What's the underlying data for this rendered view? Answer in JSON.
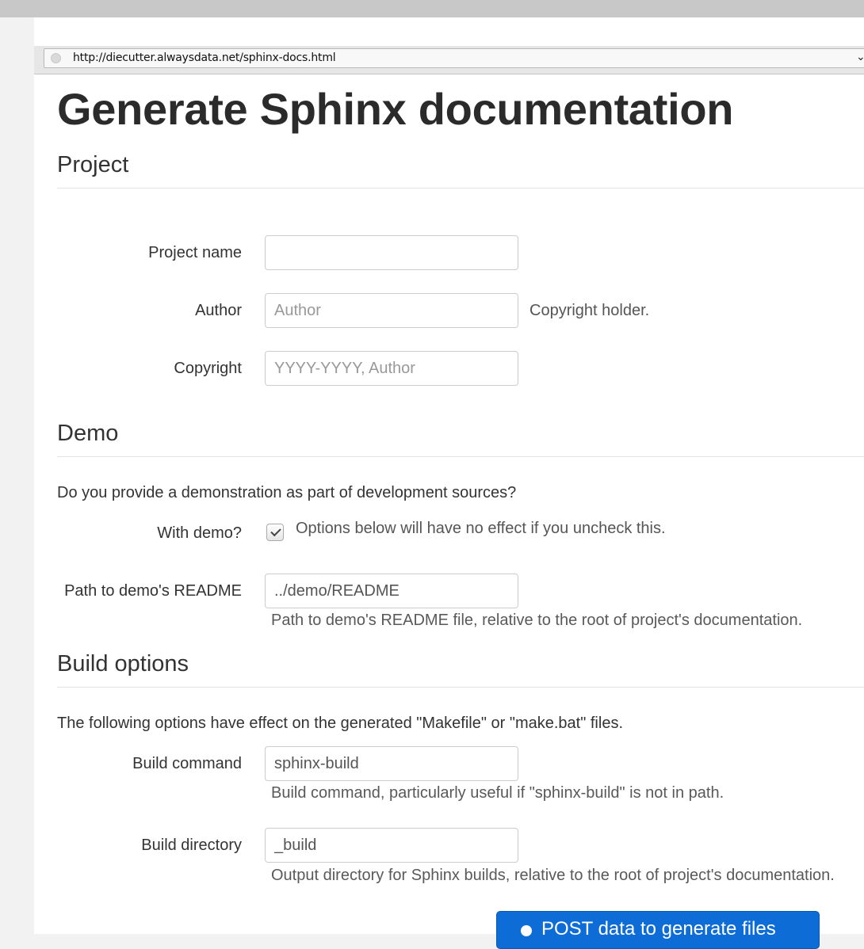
{
  "browser": {
    "url": "http://diecutter.alwaysdata.net/sphinx-docs.html"
  },
  "page": {
    "title": "Generate Sphinx documentation",
    "project": {
      "legend": "Project",
      "name_label": "Project name",
      "name_value": "",
      "author_label": "Author",
      "author_placeholder": "Author",
      "author_help": "Copyright holder.",
      "copyright_label": "Copyright",
      "copyright_placeholder": "YYYY-YYYY, Author"
    },
    "demo": {
      "legend": "Demo",
      "description": "Do you provide a demonstration as part of development sources?",
      "with_demo_label": "With demo?",
      "with_demo_checked": true,
      "with_demo_help": "Options below will have no effect if you uncheck this.",
      "readme_label": "Path to demo's README",
      "readme_value": "../demo/README",
      "readme_help": "Path to demo's README file, relative to the root of project's documentation."
    },
    "build": {
      "legend": "Build options",
      "description": "The following options have effect on the generated \"Makefile\" or \"make.bat\" files.",
      "command_label": "Build command",
      "command_value": "sphinx-build",
      "command_help": "Build command, particularly useful if \"sphinx-build\" is not in path.",
      "directory_label": "Build directory",
      "directory_value": "_build",
      "directory_help": "Output directory for Sphinx builds, relative to the root of project's documentation."
    },
    "submit_label": "POST data to generate files"
  },
  "colors": {
    "primary_button": "#0d6cd6",
    "text": "#333333",
    "help_text": "#595959"
  }
}
